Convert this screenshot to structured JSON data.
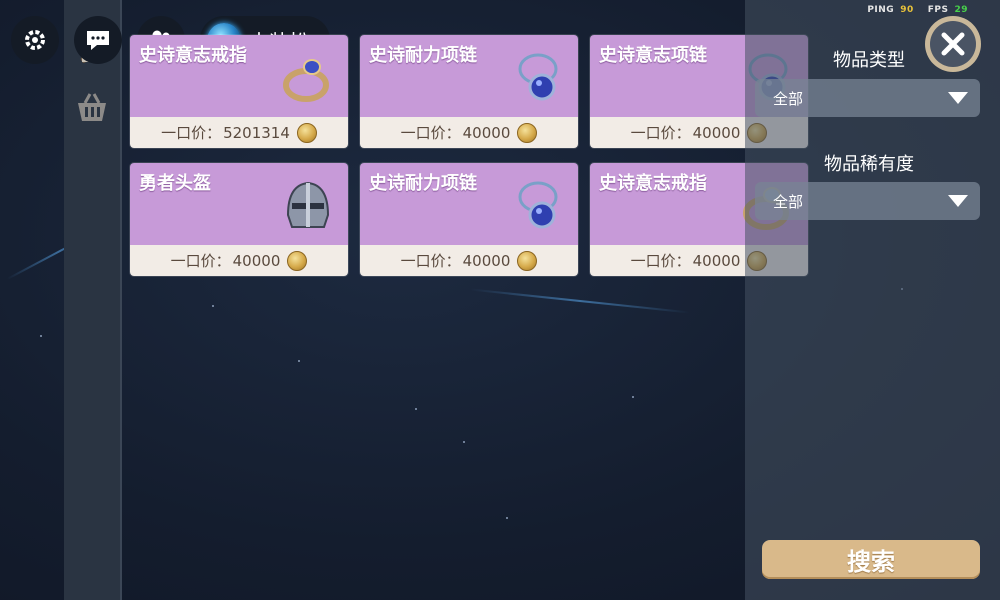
{
  "hud": {
    "ping_label": "PING",
    "ping_value": "90",
    "fps_label": "FPS",
    "fps_value": "29",
    "dress_up_label": "去装扮"
  },
  "listings": [
    {
      "name": "史诗意志戒指",
      "price_label": "一口价：",
      "price": "5201314",
      "item_icon": "ring-icon"
    },
    {
      "name": "史诗耐力项链",
      "price_label": "一口价：",
      "price": "40000",
      "item_icon": "necklace-icon"
    },
    {
      "name": "史诗意志项链",
      "price_label": "一口价：",
      "price": "40000",
      "item_icon": "necklace-icon"
    },
    {
      "name": "勇者头盔",
      "price_label": "一口价：",
      "price": "40000",
      "item_icon": "helmet-icon"
    },
    {
      "name": "史诗耐力项链",
      "price_label": "一口价：",
      "price": "40000",
      "item_icon": "necklace-icon"
    },
    {
      "name": "史诗意志戒指",
      "price_label": "一口价：",
      "price": "40000",
      "item_icon": "ring-icon"
    }
  ],
  "filters": {
    "type_label": "物品类型",
    "type_value": "全部",
    "rarity_label": "物品稀有度",
    "rarity_value": "全部",
    "search_label": "搜索"
  },
  "colors": {
    "card_header": "#c79ad8",
    "card_footer": "#f2ece6",
    "search_button": "#d9b98a",
    "ping": "#e8c23a",
    "fps": "#47d14a"
  }
}
